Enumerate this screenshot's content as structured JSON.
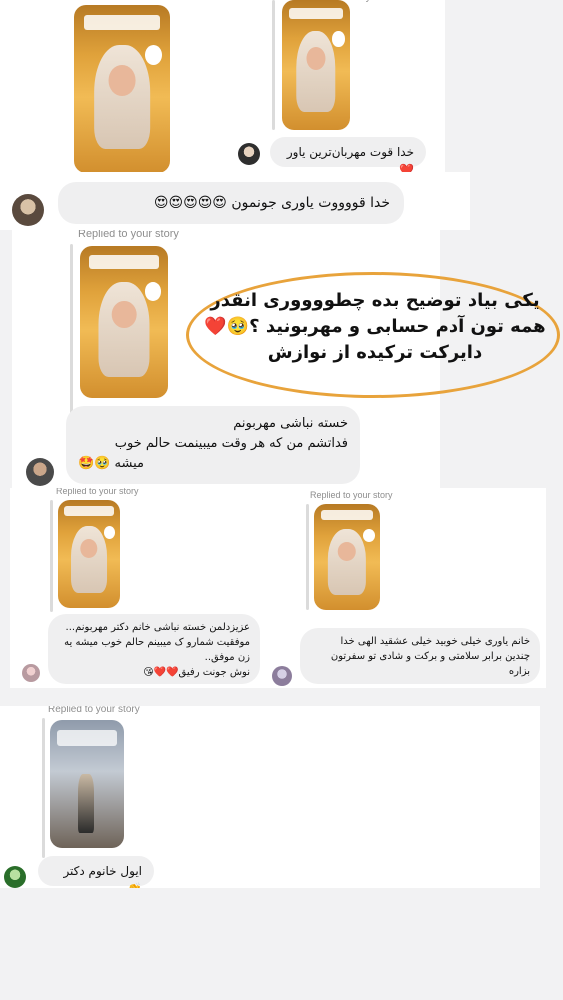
{
  "replied_label": "Replied to your story",
  "messages": [
    {
      "text": "خدا قوت مهربان‌ترین یاور❤️"
    },
    {
      "text": "خدا قووووت یاوری جونمون 😍😍😍😍😍"
    },
    {
      "lines": [
        "خسته نباشی مهربونم",
        "فداتشم من که هر وقت میبینمت حالم خوب",
        "میشه 🥹🤩"
      ]
    },
    {
      "lines": [
        "عزیزدلمن خسته نباشی خانم دکتر مهربونم...",
        "موفقیت شمارو ک میبینم حالم خوب میشه یه",
        "زن موفق..",
        "نوش جونت رفیق❤️❤️😘"
      ]
    },
    {
      "lines": [
        "خانم یاوری خیلی خوبید خیلی عشقید الهی خدا",
        "چندین برابر سلامتی و برکت و شادی تو سفرتون",
        "بزاره"
      ]
    },
    {
      "text": "ایول خانوم دکتر👏"
    }
  ],
  "callout": {
    "lines": [
      "یکی بیاد توضیح بده چطووووری انقدر",
      "همه تون آدم حسابی و مهربونید ؟🥹❤️",
      "دایرکت ترکیده از نوازش"
    ]
  }
}
